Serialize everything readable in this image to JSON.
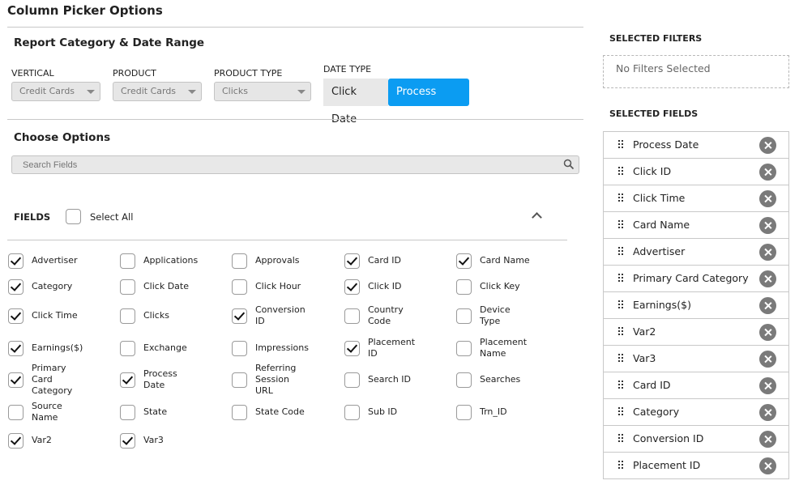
{
  "page_title": "Column Picker Options",
  "report_section": {
    "title": "Report Category & Date Range",
    "vertical": {
      "label": "VERTICAL",
      "value": "Credit Cards"
    },
    "product": {
      "label": "PRODUCT",
      "value": "Credit Cards"
    },
    "product_type": {
      "label": "PRODUCT TYPE",
      "value": "Clicks"
    },
    "date_type": {
      "label": "DATE TYPE",
      "options": [
        "Click Date",
        "Process Date"
      ],
      "selected": "Process Date"
    }
  },
  "choose_options": {
    "title": "Choose Options",
    "search_placeholder": "Search Fields",
    "fields_label": "FIELDS",
    "select_all_label": "Select All",
    "select_all_checked": false,
    "fields": [
      {
        "label": "Advertiser",
        "checked": true
      },
      {
        "label": "Applications",
        "checked": false
      },
      {
        "label": "Approvals",
        "checked": false
      },
      {
        "label": "Card ID",
        "checked": true
      },
      {
        "label": "Card Name",
        "checked": true
      },
      {
        "label": "Category",
        "checked": true
      },
      {
        "label": "Click Date",
        "checked": false
      },
      {
        "label": "Click Hour",
        "checked": false
      },
      {
        "label": "Click ID",
        "checked": true
      },
      {
        "label": "Click Key",
        "checked": false
      },
      {
        "label": "Click Time",
        "checked": true
      },
      {
        "label": "Clicks",
        "checked": false
      },
      {
        "label": "Conversion ID",
        "checked": true
      },
      {
        "label": "Country Code",
        "checked": false
      },
      {
        "label": "Device Type",
        "checked": false
      },
      {
        "label": "Earnings($)",
        "checked": true
      },
      {
        "label": "Exchange",
        "checked": false
      },
      {
        "label": "Impressions",
        "checked": false
      },
      {
        "label": "Placement ID",
        "checked": true
      },
      {
        "label": "Placement Name",
        "checked": false
      },
      {
        "label": "Primary Card Category",
        "checked": true
      },
      {
        "label": "Process Date",
        "checked": true
      },
      {
        "label": "Referring Session URL",
        "checked": false
      },
      {
        "label": "Search ID",
        "checked": false
      },
      {
        "label": "Searches",
        "checked": false
      },
      {
        "label": "Source Name",
        "checked": false
      },
      {
        "label": "State",
        "checked": false
      },
      {
        "label": "State Code",
        "checked": false
      },
      {
        "label": "Sub ID",
        "checked": false
      },
      {
        "label": "Trn_ID",
        "checked": false
      },
      {
        "label": "Var2",
        "checked": true
      },
      {
        "label": "Var3",
        "checked": true
      }
    ]
  },
  "selected_filters": {
    "title": "SELECTED FILTERS",
    "empty_text": "No Filters Selected"
  },
  "selected_fields": {
    "title": "SELECTED FIELDS",
    "items": [
      "Process Date",
      "Click ID",
      "Click Time",
      "Card Name",
      "Advertiser",
      "Primary Card Category",
      "Earnings($)",
      "Var2",
      "Var3",
      "Card ID",
      "Category",
      "Conversion ID",
      "Placement ID"
    ]
  },
  "colors": {
    "accent": "#0b9cf2",
    "remove_button": "#7a7a7a"
  }
}
